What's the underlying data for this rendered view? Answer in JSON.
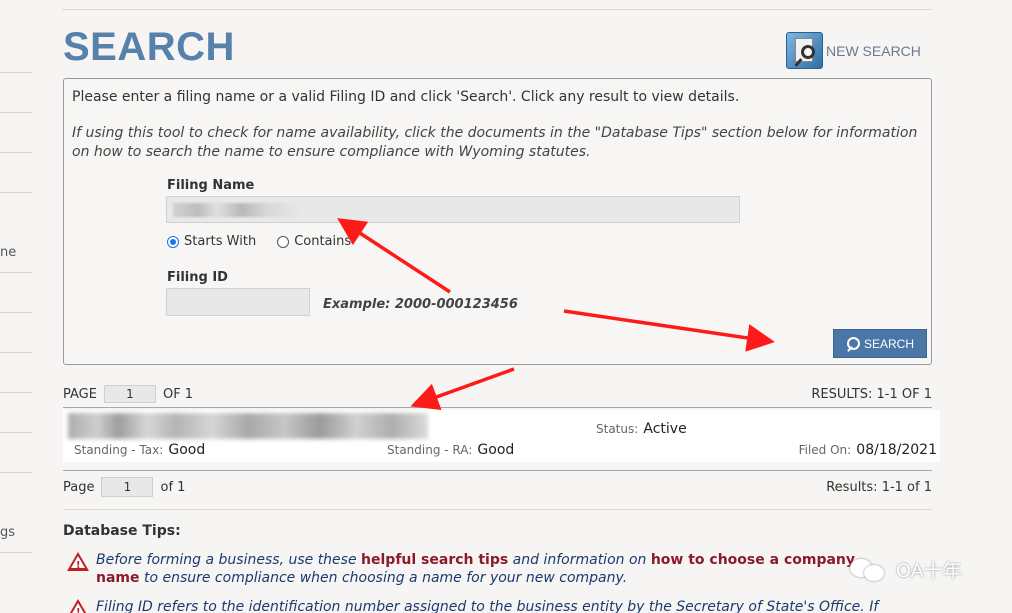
{
  "sidebar": {
    "fragment_1": "ne",
    "fragment_2": "gs"
  },
  "header": {
    "title": "SEARCH",
    "new_search_label": "NEW SEARCH"
  },
  "panel": {
    "intro": "Please enter a filing name or a valid Filing ID and click 'Search'. Click any result to view details.",
    "note": "If using this tool to check for name availability, click the documents in the \"Database Tips\" section below for information on how to search the name to ensure compliance with Wyoming statutes.",
    "filing_name_label": "Filing Name",
    "filing_name_value": "",
    "radio_starts_with": "Starts With",
    "radio_contains": "Contains",
    "selected_option": "Starts With",
    "filing_id_label": "Filing ID",
    "filing_id_value": "",
    "example_text": "Example: 2000-000123456",
    "search_button": "SEARCH"
  },
  "pager_top": {
    "page_label": "PAGE",
    "page_value": "1",
    "of_label": "OF 1",
    "results": "RESULTS: 1-1 OF 1"
  },
  "result": {
    "status_label": "Status:",
    "status_value": "Active",
    "tax_label": "Standing - Tax:",
    "tax_value": "Good",
    "ra_label": "Standing - RA:",
    "ra_value": "Good",
    "filed_label": "Filed On:",
    "filed_value": "08/18/2021"
  },
  "pager_bottom": {
    "page_label": "Page",
    "page_value": "1",
    "of_label": "of 1",
    "results": "Results: 1-1 of 1"
  },
  "tips": {
    "heading": "Database Tips:",
    "tip1_a": "Before forming a business, use these ",
    "tip1_link1": "helpful search tips",
    "tip1_b": " and information on ",
    "tip1_link2": "how to choose a company name",
    "tip1_c": " to ensure compliance when choosing a name for your new company.",
    "tip2": "Filing ID refers to the identification number assigned to the business entity by the Secretary of State's Office. If"
  },
  "watermark": {
    "text": "OA十年"
  },
  "colors": {
    "title": "#5681aa",
    "button": "#4a76a8",
    "link": "#8b1a2b",
    "arrow": "#ff1a1a"
  }
}
